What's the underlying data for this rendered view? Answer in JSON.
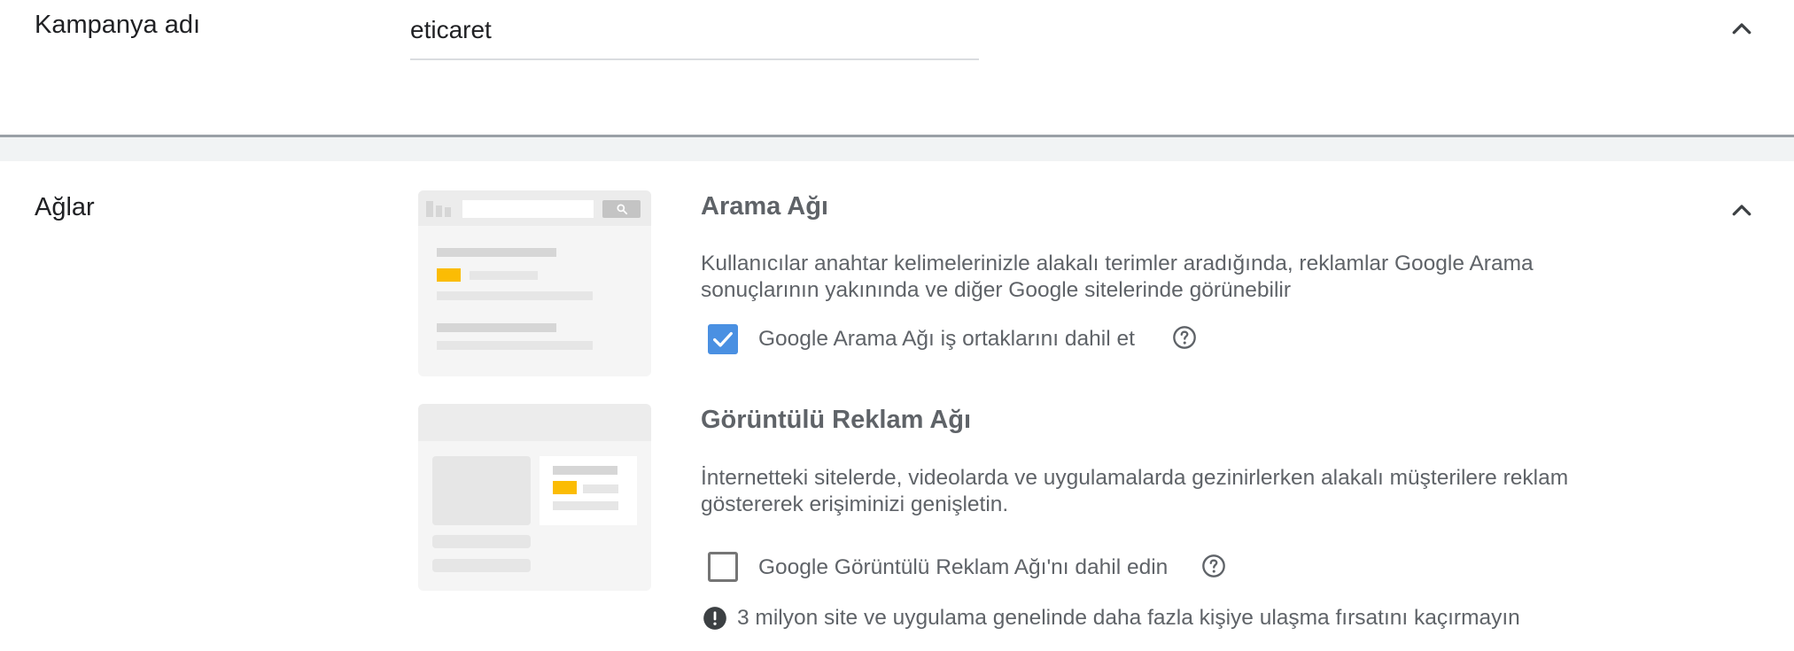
{
  "campaign": {
    "label": "Kampanya adı",
    "value": "eticaret"
  },
  "networks": {
    "label": "Ağlar",
    "search": {
      "title": "Arama Ağı",
      "description_line1": "Kullanıcılar anahtar kelimelerinizle alakalı terimler aradığında, reklamlar Google Arama",
      "description_line2": "sonuçlarının yakınında ve diğer Google sitelerinde görünebilir",
      "checkbox_label": "Google Arama Ağı iş ortaklarını dahil et",
      "checked": true
    },
    "display": {
      "title": "Görüntülü Reklam Ağı",
      "description_line1": "İnternetteki sitelerde, videolarda ve uygulamalarda gezinirlerken alakalı müşterilere reklam",
      "description_line2": "göstererek erişiminizi genişletin.",
      "checkbox_label": "Google Görüntülü Reklam Ağı'nı dahil edin",
      "checked": false,
      "notice": "3 milyon site ve uygulama genelinde daha fazla kişiye ulaşma fırsatını kaçırmayın"
    }
  },
  "colors": {
    "accent": "#4a90e2",
    "highlight": "#fbbc04",
    "text_secondary": "#5f6368"
  },
  "icons": {
    "collapse": "chevron-up-icon",
    "help": "help-circle-icon",
    "notice": "exclamation-circle-icon",
    "check": "check-icon",
    "search": "search-icon"
  }
}
